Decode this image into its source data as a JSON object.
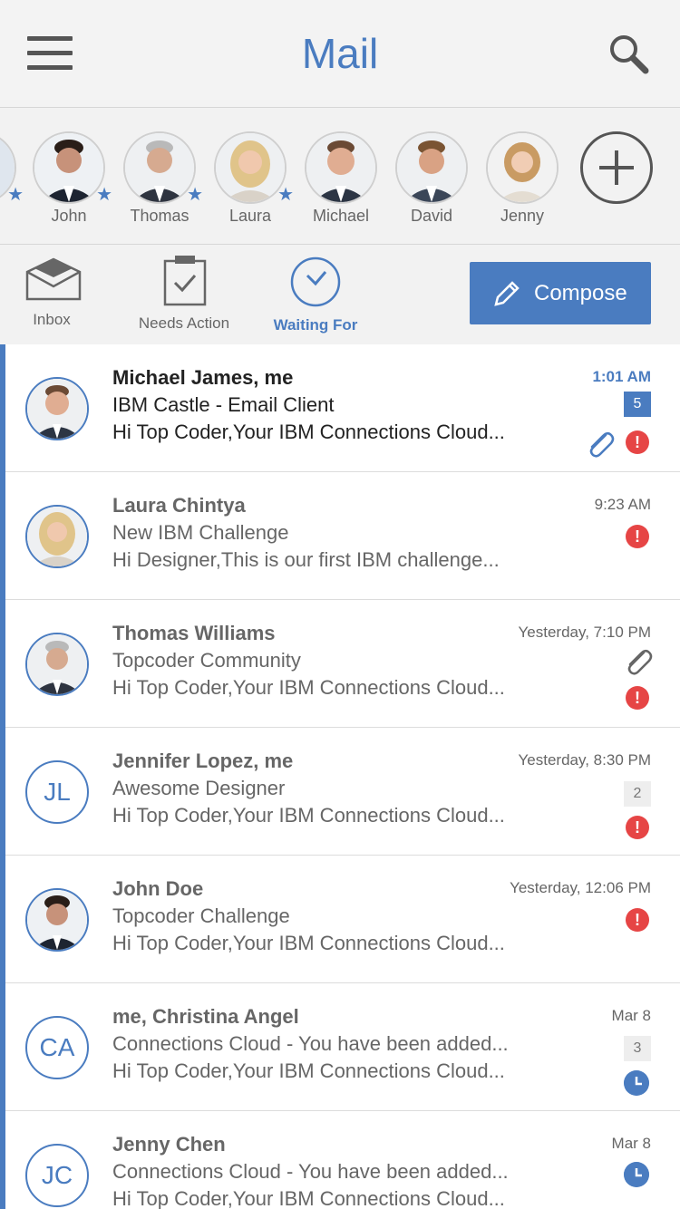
{
  "header": {
    "title": "Mail"
  },
  "contacts": [
    {
      "name": "",
      "starred": true,
      "partial": true
    },
    {
      "name": "John",
      "starred": true
    },
    {
      "name": "Thomas",
      "starred": true
    },
    {
      "name": "Laura",
      "starred": true
    },
    {
      "name": "Michael",
      "starred": false
    },
    {
      "name": "David",
      "starred": false
    },
    {
      "name": "Jenny",
      "starred": false
    }
  ],
  "folders": {
    "inbox": "Inbox",
    "needs_action": "Needs Action",
    "waiting_for": "Waiting For",
    "compose": "Compose"
  },
  "messages": [
    {
      "sender": "Michael James, me",
      "subject": "IBM Castle - Email Client",
      "preview": "Hi Top Coder,Your IBM Connections Cloud...",
      "time": "1:01 AM",
      "count": "5",
      "unread": true,
      "attachment": true,
      "alert": true,
      "avatar": "photo"
    },
    {
      "sender": "Laura Chintya",
      "subject": "New IBM Challenge",
      "preview": "Hi Designer,This is our first IBM challenge...",
      "time": "9:23 AM",
      "alert": true,
      "avatar": "photo"
    },
    {
      "sender": "Thomas Williams",
      "subject": "Topcoder Community",
      "preview": "Hi Top Coder,Your IBM Connections Cloud...",
      "time": "Yesterday, 7:10 PM",
      "attachment": true,
      "alert": true,
      "avatar": "photo"
    },
    {
      "sender": "Jennifer Lopez, me",
      "subject": "Awesome Designer",
      "preview": "Hi Top Coder,Your IBM Connections Cloud...",
      "time": "Yesterday, 8:30 PM",
      "count": "2",
      "alert": true,
      "avatar": "JL"
    },
    {
      "sender": "John Doe",
      "subject": "Topcoder Challenge",
      "preview": "Hi Top Coder,Your IBM Connections Cloud...",
      "time": "Yesterday, 12:06 PM",
      "alert": true,
      "avatar": "photo"
    },
    {
      "sender": "me, Christina Angel",
      "subject": "Connections Cloud - You have been added...",
      "preview": "Hi Top Coder,Your IBM Connections Cloud...",
      "time": "Mar 8",
      "count": "3",
      "waiting": true,
      "avatar": "CA"
    },
    {
      "sender": "Jenny Chen",
      "subject": "Connections Cloud - You have been added...",
      "preview": "Hi Top Coder,Your IBM Connections Cloud...",
      "time": "Mar 8",
      "waiting": true,
      "avatar": "JC"
    }
  ]
}
